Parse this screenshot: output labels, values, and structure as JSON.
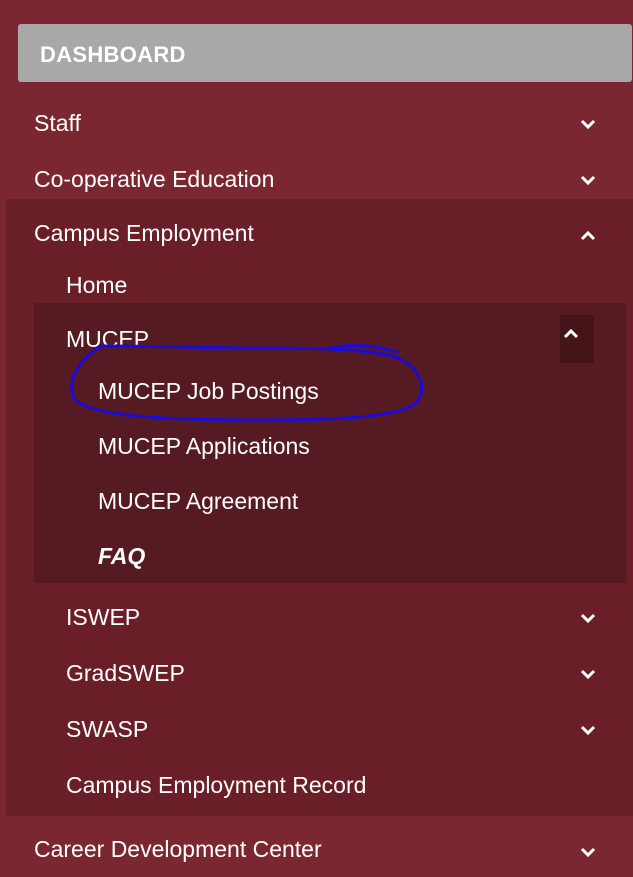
{
  "dashboard": {
    "label": "DASHBOARD"
  },
  "menu": {
    "staff": {
      "label": "Staff",
      "state": "collapsed"
    },
    "coop": {
      "label": "Co-operative Education",
      "state": "collapsed"
    },
    "campus": {
      "label": "Campus Employment",
      "state": "expanded",
      "items": {
        "home": {
          "label": "Home"
        },
        "mucep": {
          "label": "MUCEP",
          "state": "expanded",
          "items": {
            "job_postings": {
              "label": "MUCEP Job Postings"
            },
            "applications": {
              "label": "MUCEP Applications"
            },
            "agreement": {
              "label": "MUCEP Agreement"
            },
            "faq": {
              "label": "FAQ"
            }
          }
        },
        "iswep": {
          "label": "ISWEP",
          "state": "collapsed"
        },
        "gradswep": {
          "label": "GradSWEP",
          "state": "collapsed"
        },
        "swasp": {
          "label": "SWASP",
          "state": "collapsed"
        },
        "record": {
          "label": "Campus Employment Record"
        }
      }
    },
    "career": {
      "label": "Career Development Center",
      "state": "collapsed"
    }
  },
  "icons": {
    "collapsed": "chevron-down-icon",
    "expanded": "chevron-up-icon"
  },
  "colors": {
    "nav_background": "#7b2731",
    "campus_background": "#6a1f28",
    "mucep_background": "#561b22",
    "dashboard_background": "#a8a8a8",
    "annotation_stroke": "#1a0bdc"
  }
}
